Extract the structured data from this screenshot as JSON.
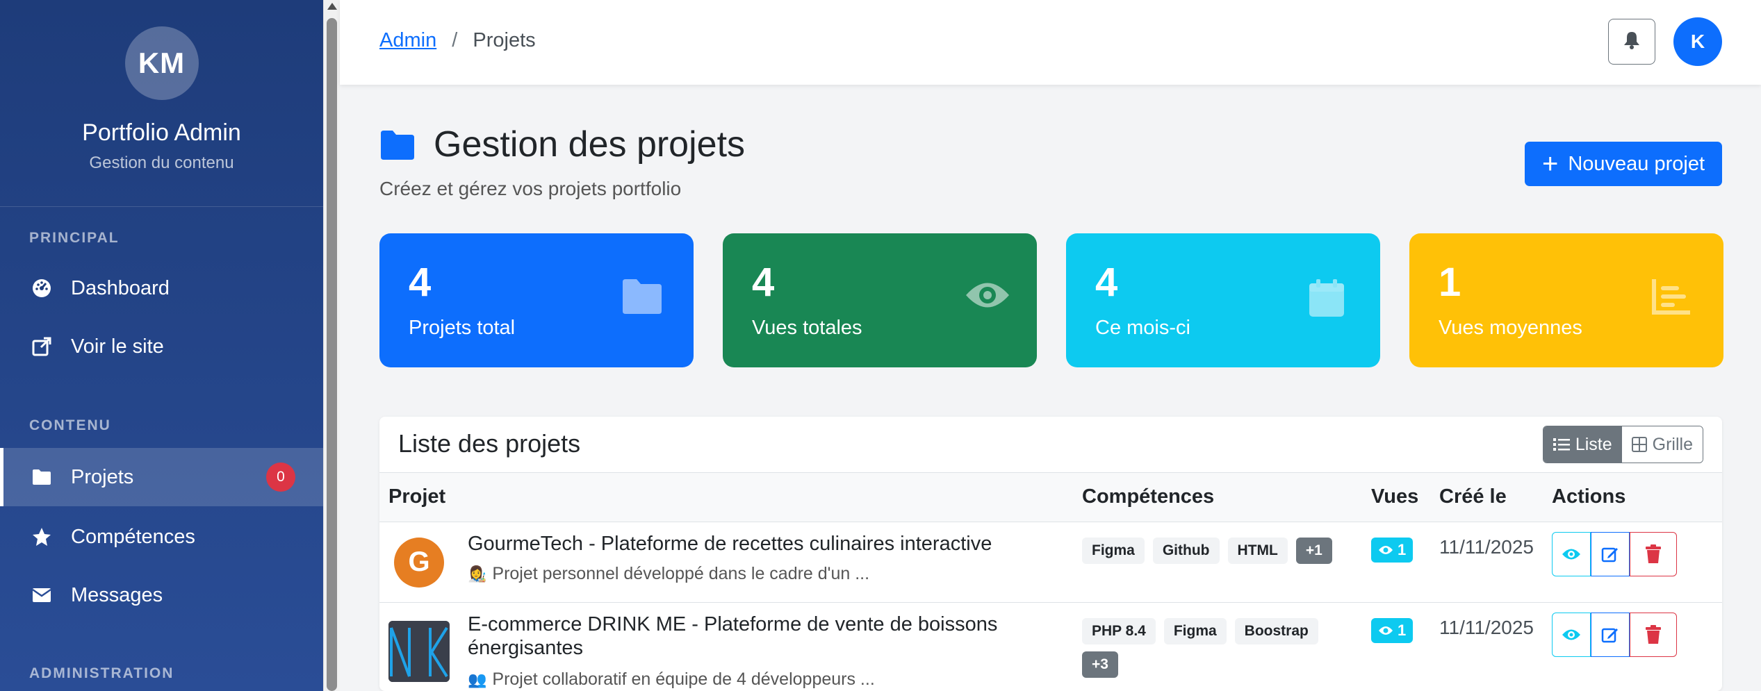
{
  "sidebar": {
    "avatar_initials": "KM",
    "title": "Portfolio Admin",
    "subtitle": "Gestion du contenu",
    "sections": {
      "principal": "PRINCIPAL",
      "contenu": "CONTENU",
      "administration": "ADMINISTRATION"
    },
    "items": [
      {
        "label": "Dashboard",
        "icon": "dashboard-icon"
      },
      {
        "label": "Voir le site",
        "icon": "external-link-icon"
      },
      {
        "label": "Projets",
        "icon": "folder-icon",
        "badge": "0",
        "active": true
      },
      {
        "label": "Compétences",
        "icon": "star-icon"
      },
      {
        "label": "Messages",
        "icon": "envelope-icon"
      }
    ]
  },
  "topbar": {
    "breadcrumb": {
      "root": "Admin",
      "separator": "/",
      "current": "Projets"
    },
    "user_initial": "K"
  },
  "page": {
    "title": "Gestion des projets",
    "subtitle": "Créez et gérez vos projets portfolio",
    "new_button": "Nouveau projet"
  },
  "stats": [
    {
      "value": "4",
      "label": "Projets total",
      "color": "#0d6efd",
      "icon": "folder-icon"
    },
    {
      "value": "4",
      "label": "Vues totales",
      "color": "#198754",
      "icon": "eye-icon"
    },
    {
      "value": "4",
      "label": "Ce mois-ci",
      "color": "#0dcaf0",
      "icon": "calendar-icon"
    },
    {
      "value": "1",
      "label": "Vues moyennes",
      "color": "#ffc107",
      "icon": "chart-icon"
    }
  ],
  "list": {
    "title": "Liste des projets",
    "view_toggle": {
      "list": "Liste",
      "grid": "Grille"
    },
    "columns": [
      "Projet",
      "Compétences",
      "Vues",
      "Créé le",
      "Actions"
    ],
    "rows": [
      {
        "thumb_letter": "G",
        "title": "GourmeTech - Plateforme de recettes culinaires interactive",
        "desc_emoji": "👩‍🎨",
        "description": "Projet personnel développé dans le cadre d'un ...",
        "skills": [
          "Figma",
          "Github",
          "HTML"
        ],
        "more": "+1",
        "views": "1",
        "created": "11/11/2025"
      },
      {
        "thumb_letter": "",
        "title": "E-commerce DRINK ME - Plateforme de vente de boissons énergisantes",
        "desc_emoji": "👥",
        "description": "Projet collaboratif en équipe de 4 développeurs ...",
        "skills": [
          "PHP 8.4",
          "Figma",
          "Boostrap"
        ],
        "more": "+3",
        "views": "1",
        "created": "11/11/2025"
      }
    ]
  }
}
